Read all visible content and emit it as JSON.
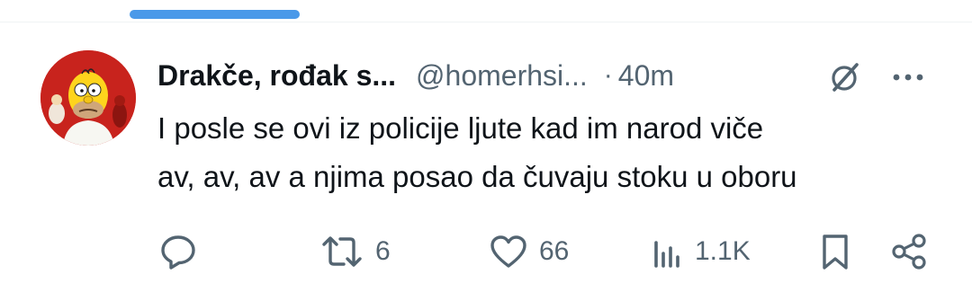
{
  "tweet": {
    "display_name": "Drakče, rođak s...",
    "handle": "@homerhsi...",
    "separator": "·",
    "time": "40m",
    "text_lines": [
      "I posle se ovi iz policije ljute kad im narod viče",
      "av, av, av a njima posao da čuvaju stoku u oboru"
    ]
  },
  "actions": {
    "reply_count": "",
    "retweet_count": "6",
    "like_count": "66",
    "views_count": "1.1K"
  },
  "icons": {
    "reply": "speech-bubble-icon",
    "retweet": "retweet-arrows-icon",
    "like": "heart-icon",
    "views": "bar-chart-icon",
    "bookmark": "bookmark-icon",
    "share": "share-nodes-icon",
    "grok": "grok-slash-circle-icon",
    "more": "more-dots-icon"
  },
  "colors": {
    "accent": "#4a99e9",
    "text_primary": "#0f1419",
    "text_secondary": "#536471"
  }
}
